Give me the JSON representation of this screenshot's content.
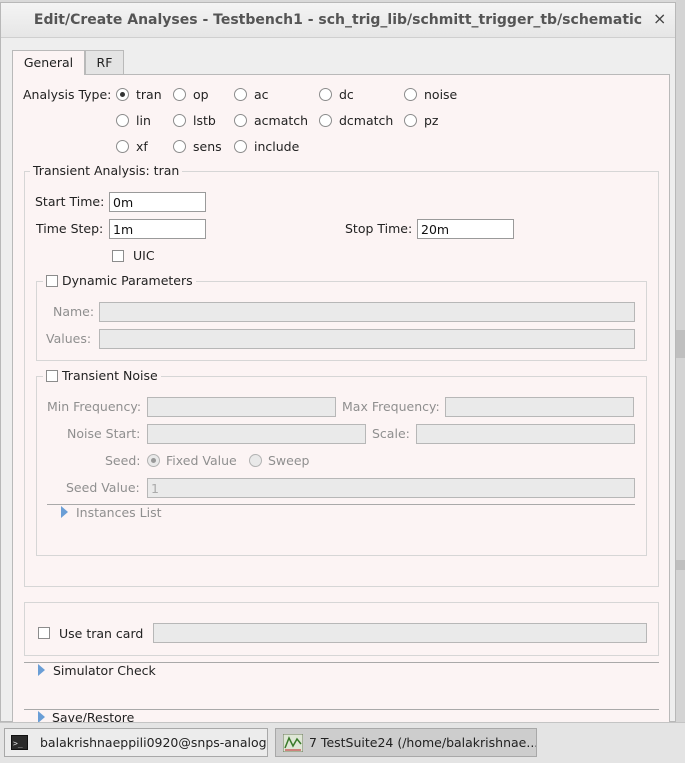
{
  "window": {
    "title": "Edit/Create Analyses - Testbench1 - sch_trig_lib/schmitt_trigger_tb/schematic",
    "close_glyph": "×"
  },
  "tabs": [
    {
      "label": "General",
      "active": true
    },
    {
      "label": "RF",
      "active": false
    }
  ],
  "analysis_type": {
    "label": "Analysis Type:",
    "selected": "tran",
    "options": [
      "tran",
      "op",
      "ac",
      "dc",
      "noise",
      "lin",
      "lstb",
      "acmatch",
      "dcmatch",
      "pz",
      "xf",
      "sens",
      "include"
    ]
  },
  "transient": {
    "group_title": "Transient Analysis: tran",
    "start_time_label": "Start Time:",
    "start_time": "0m",
    "time_step_label": "Time Step:",
    "time_step": "1m",
    "stop_time_label": "Stop Time:",
    "stop_time": "20m",
    "uic_label": "UIC"
  },
  "dynamic_parameters": {
    "label": "Dynamic Parameters",
    "name_label": "Name:",
    "name_value": "",
    "values_label": "Values:",
    "values_value": ""
  },
  "transient_noise": {
    "label": "Transient Noise",
    "min_freq_label": "Min Frequency:",
    "max_freq_label": "Max Frequency:",
    "noise_start_label": "Noise Start:",
    "scale_label": "Scale:",
    "seed_label": "Seed:",
    "seed_fixed": "Fixed Value",
    "seed_sweep": "Sweep",
    "seed_value_label": "Seed Value:",
    "seed_value": "1",
    "instances_list": "Instances List"
  },
  "tran_card": {
    "label": "Use tran card",
    "value": ""
  },
  "simulator_check": "Simulator Check",
  "save_restore": "Save/Restore",
  "taskbar": [
    {
      "label": "balakrishnaeppili0920@snps-analog-...",
      "icon": "terminal-icon"
    },
    {
      "label": "7 TestSuite24 (/home/balakrishnae...",
      "icon": "waveform-icon"
    }
  ]
}
